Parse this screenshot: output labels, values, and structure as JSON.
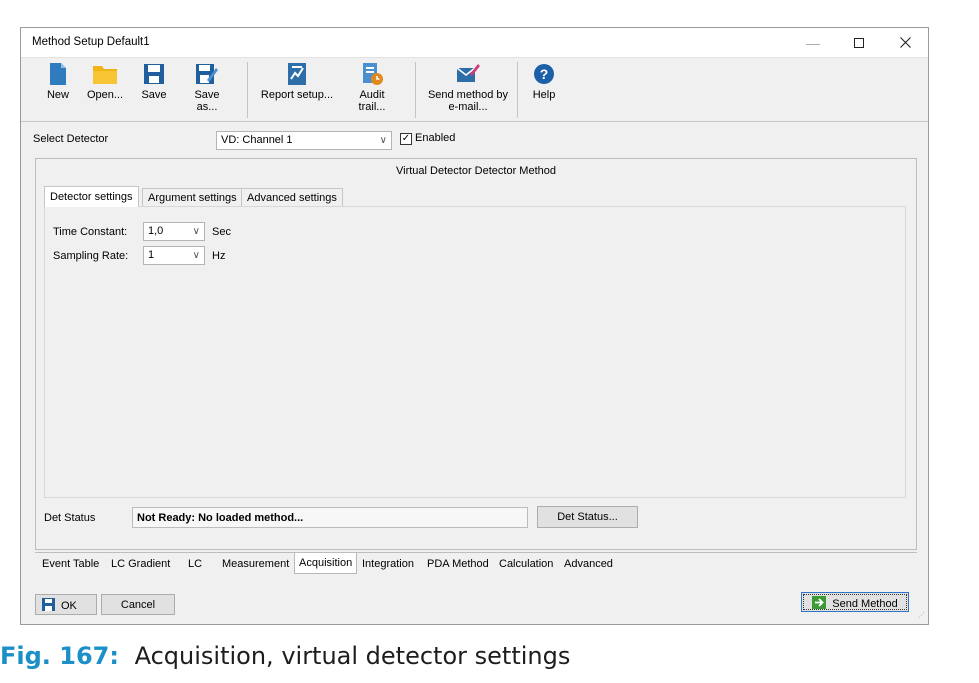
{
  "window": {
    "title": "Method Setup Default1"
  },
  "toolbar": {
    "new": "New",
    "open": "Open...",
    "save": "Save",
    "save_as": "Save as...",
    "report_setup": "Report setup...",
    "audit_trail": "Audit trail...",
    "send_method_line1": "Send method by",
    "send_method_line2": "e-mail...",
    "help": "Help"
  },
  "detector": {
    "label": "Select Detector",
    "selected": "VD: Channel 1",
    "enabled_label": "Enabled",
    "enabled": true
  },
  "method_group": {
    "title": "Virtual Detector Detector Method",
    "tabs": [
      "Detector settings",
      "Argument settings",
      "Advanced settings"
    ],
    "active_tab": "Detector settings",
    "time_constant": {
      "label": "Time Constant:",
      "value": "1,0",
      "unit": "Sec"
    },
    "sampling_rate": {
      "label": "Sampling Rate:",
      "value": "1",
      "unit": "Hz"
    },
    "det_status": {
      "label": "Det Status",
      "value": "Not Ready: No loaded method...",
      "button": "Det Status..."
    }
  },
  "bottom_tabs": [
    "Event Table",
    "LC Gradient",
    "LC",
    "Measurement",
    "Acquisition",
    "Integration",
    "PDA Method",
    "Calculation",
    "Advanced"
  ],
  "bottom_active": "Acquisition",
  "footer": {
    "ok": "OK",
    "cancel": "Cancel",
    "send_method": "Send Method"
  },
  "caption": {
    "fig": "Fig. 167:",
    "text": "Acquisition, virtual detector settings"
  },
  "colors": {
    "accent": "#1b8fc7",
    "icon_blue": "#2e6ea8",
    "icon_folder": "#f2b316",
    "help_blue": "#1c5fa8"
  }
}
